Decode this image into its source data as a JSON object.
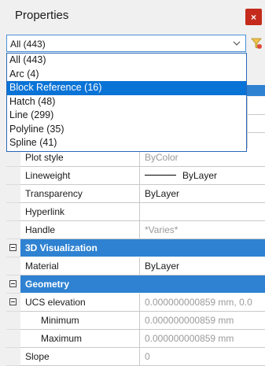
{
  "window": {
    "title": "Properties",
    "close_glyph": "×"
  },
  "selector": {
    "current": "All (443)",
    "options": [
      "All (443)",
      "Arc (4)",
      "Block Reference (16)",
      "Hatch (48)",
      "Line (299)",
      "Polyline (35)",
      "Spline (41)"
    ],
    "highlighted_index": 2
  },
  "rows_general": [
    {
      "name": "Plot style",
      "value": "ByColor",
      "value_style": "grey"
    },
    {
      "name": "Lineweight",
      "value": "ByLayer",
      "has_line_swatch": true
    },
    {
      "name": "Transparency",
      "value": "ByLayer"
    },
    {
      "name": "Hyperlink",
      "value": ""
    },
    {
      "name": "Handle",
      "value": "*Varies*",
      "value_style": "grey"
    }
  ],
  "section_3d": {
    "label": "3D Visualization"
  },
  "rows_3d": [
    {
      "name": "Material",
      "value": "ByLayer"
    }
  ],
  "section_geometry": {
    "label": "Geometry"
  },
  "rows_geometry": [
    {
      "name": "UCS elevation",
      "value": "0.000000000859 mm, 0.0",
      "value_style": "grey",
      "expandable": true
    },
    {
      "name": "Minimum",
      "value": "0.000000000859 mm",
      "value_style": "grey",
      "indent": true
    },
    {
      "name": "Maximum",
      "value": "0.000000000859 mm",
      "value_style": "grey",
      "indent": true
    },
    {
      "name": "Slope",
      "value": "0",
      "value_style": "grey"
    }
  ],
  "icons": {
    "close": "close-icon",
    "dropdown": "chevron-down-icon",
    "filter": "filter-icon"
  },
  "colors": {
    "accent": "#2f82d2",
    "highlight": "#0a73d6",
    "close": "#c42b1c"
  }
}
